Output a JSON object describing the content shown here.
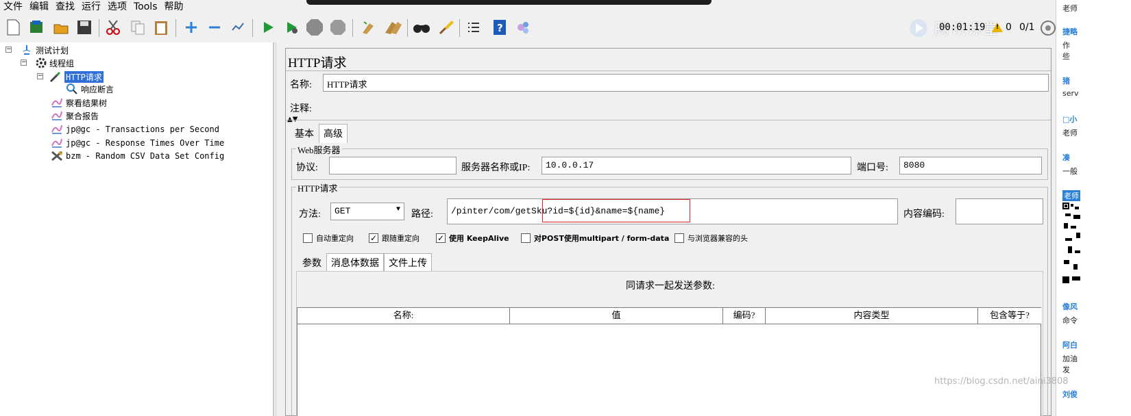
{
  "menu": [
    "文件",
    "编辑",
    "查找",
    "运行",
    "选项",
    "Tools",
    "帮助"
  ],
  "toolbar": {
    "timer": "00:01:19",
    "warning_count": "0",
    "threads": "0/1",
    "watermark_text": "腾讯课堂",
    "icons": [
      "new-icon",
      "templates-icon",
      "open-icon",
      "save-icon",
      "cut-icon",
      "copy-icon",
      "paste-icon",
      "expand-icon",
      "collapse-icon",
      "toggle-icon",
      "start-icon",
      "start-no-pause-icon",
      "stop-icon",
      "shutdown-icon",
      "clear-icon",
      "clear-all-icon",
      "search-icon",
      "reset-search-icon",
      "function-helper-icon",
      "help-icon",
      "remote-icon"
    ]
  },
  "tree": {
    "test_plan": "测试计划",
    "thread_group": "线程组",
    "http_request": "HTTP请求",
    "response_assertion": "响应断言",
    "view_results_tree": "察看结果树",
    "aggregate_report": "聚合报告",
    "tps_listener": "jp@gc - Transactions per Second",
    "rt_listener": "jp@gc - Response Times Over Time",
    "csv_config": "bzm - Random CSV Data Set Config"
  },
  "panel": {
    "title": "HTTP请求",
    "name_label": "名称:",
    "name_value": "HTTP请求",
    "comment_label": "注释:",
    "tabs": [
      "基本",
      "高级"
    ],
    "web_server": {
      "title": "Web服务器",
      "protocol_label": "协议:",
      "protocol_value": "",
      "server_label": "服务器名称或IP:",
      "server_value": "10.0.0.17",
      "port_label": "端口号:",
      "port_value": "8080"
    },
    "http_request": {
      "title": "HTTP请求",
      "method_label": "方法:",
      "method_value": "GET",
      "path_label": "路径:",
      "path_value": "/pinter/com/getSku?id=${id}&name=${name}",
      "encoding_label": "内容编码:",
      "encoding_value": ""
    },
    "checkboxes": [
      {
        "label": "自动重定向",
        "checked": false
      },
      {
        "label": "跟随重定向",
        "checked": true
      },
      {
        "label": "使用 KeepAlive",
        "checked": true
      },
      {
        "label": "对POST使用multipart / form-data",
        "checked": false
      },
      {
        "label": "与浏览器兼容的头",
        "checked": false
      }
    ],
    "sub_tabs": [
      "参数",
      "消息体数据",
      "文件上传"
    ],
    "params_caption": "同请求一起发送参数:",
    "columns": [
      "名称:",
      "值",
      "编码?",
      "内容类型",
      "包含等于?"
    ]
  },
  "side_strip": {
    "lines": [
      "老师",
      "捷略",
      "作",
      "些",
      "猪",
      "serv",
      "□小",
      "老师",
      "凑",
      "一般",
      "老师",
      "像风",
      "命令",
      "阿白",
      "加油",
      "发",
      "刘俊"
    ]
  },
  "watermark": "https://blog.csdn.net/aini3808"
}
